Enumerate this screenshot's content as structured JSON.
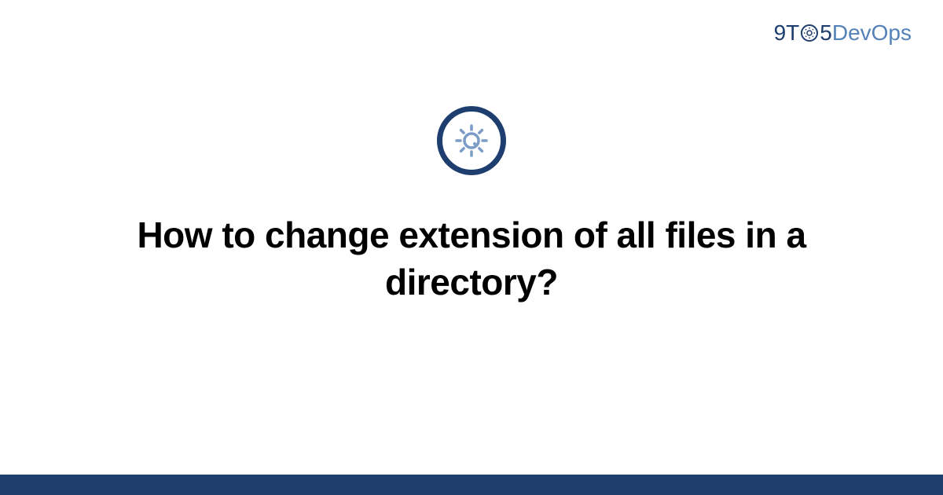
{
  "logo": {
    "nine": "9",
    "t": "T",
    "five": "5",
    "devops": "DevOps"
  },
  "title": "How to change extension of all files in a directory?",
  "colors": {
    "brand_dark": "#1d3e6e",
    "brand_light": "#5582b8",
    "icon_stroke": "#7a9cc6"
  }
}
